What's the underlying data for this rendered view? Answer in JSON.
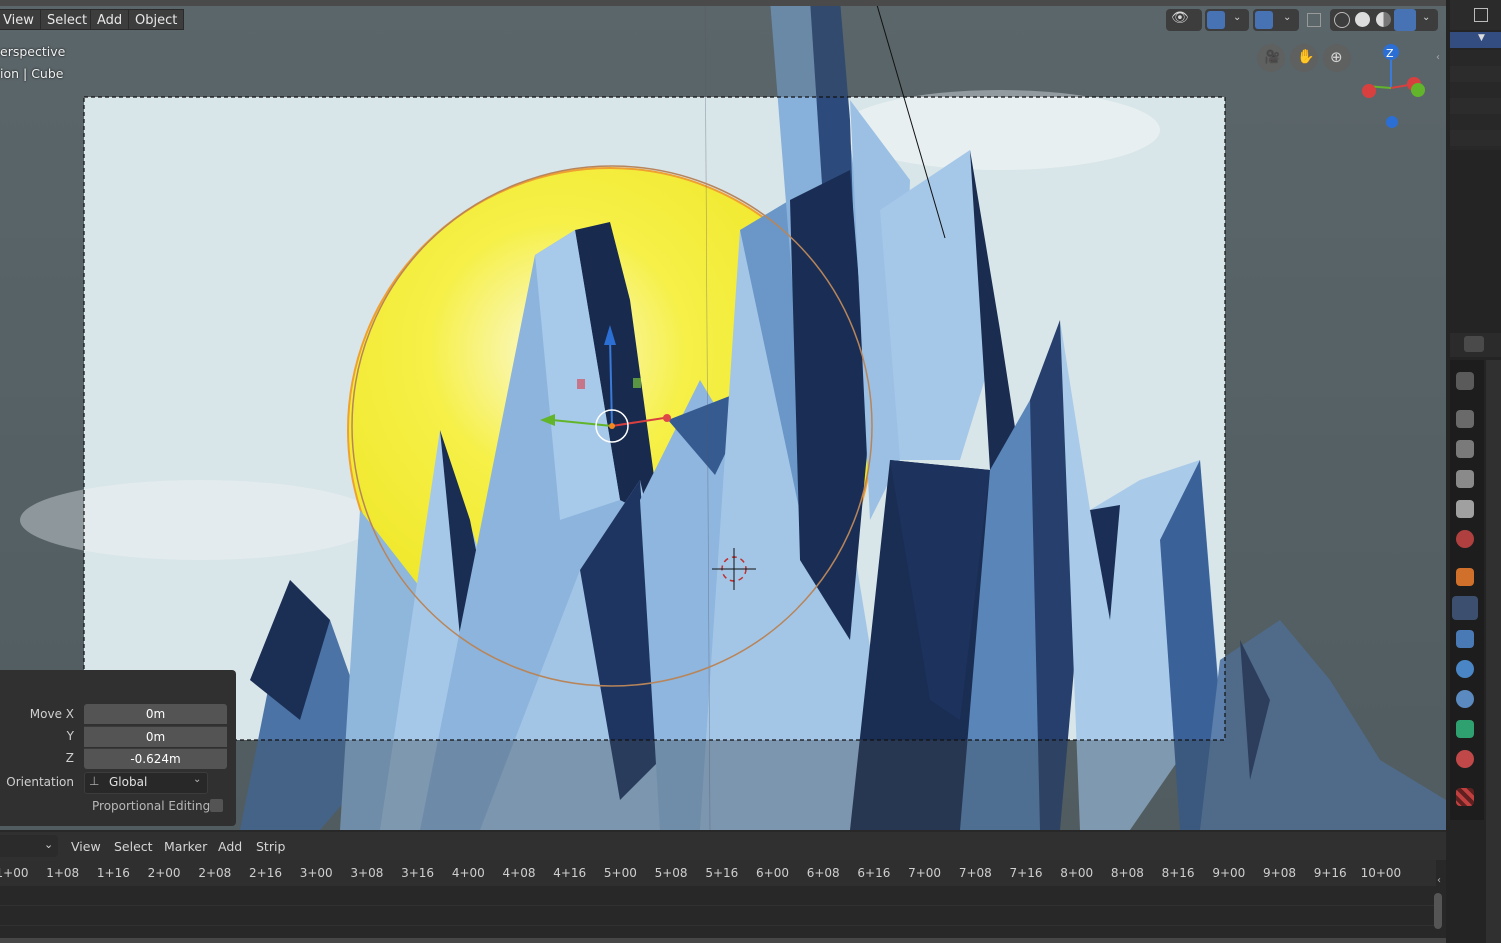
{
  "header": {
    "menus": [
      "View",
      "Select",
      "Add",
      "Object"
    ]
  },
  "viewport": {
    "overlay_line1": "erspective",
    "overlay_line2": "ion | Cube",
    "nav_icons": [
      "camera-view-icon",
      "hand-pan-icon",
      "zoom-icon"
    ],
    "gizmo_axis_label": "Z"
  },
  "operator_panel": {
    "move_x_label": "Move X",
    "move_x_value": "0m",
    "y_label": "Y",
    "y_value": "0m",
    "z_label": "Z",
    "z_value": "-0.624m",
    "orientation_label": "Orientation",
    "orientation_value": "Global",
    "proportional_label": "Proportional Editing"
  },
  "timeline": {
    "menus": [
      "View",
      "Select",
      "Marker",
      "Add",
      "Strip"
    ],
    "ticks": [
      "1+00",
      "1+08",
      "1+16",
      "2+00",
      "2+08",
      "2+16",
      "3+00",
      "3+08",
      "3+16",
      "4+00",
      "4+08",
      "4+16",
      "5+00",
      "5+08",
      "5+16",
      "6+00",
      "6+08",
      "6+16",
      "7+00",
      "7+08",
      "7+16",
      "8+00",
      "8+08",
      "8+16",
      "9+00",
      "9+08",
      "9+16",
      "10+00"
    ]
  },
  "colors": {
    "sun": "#f6ee2a",
    "sky": "#d9e6ea",
    "ice_light": "#a9cbe9",
    "ice_dark": "#172a4d"
  }
}
